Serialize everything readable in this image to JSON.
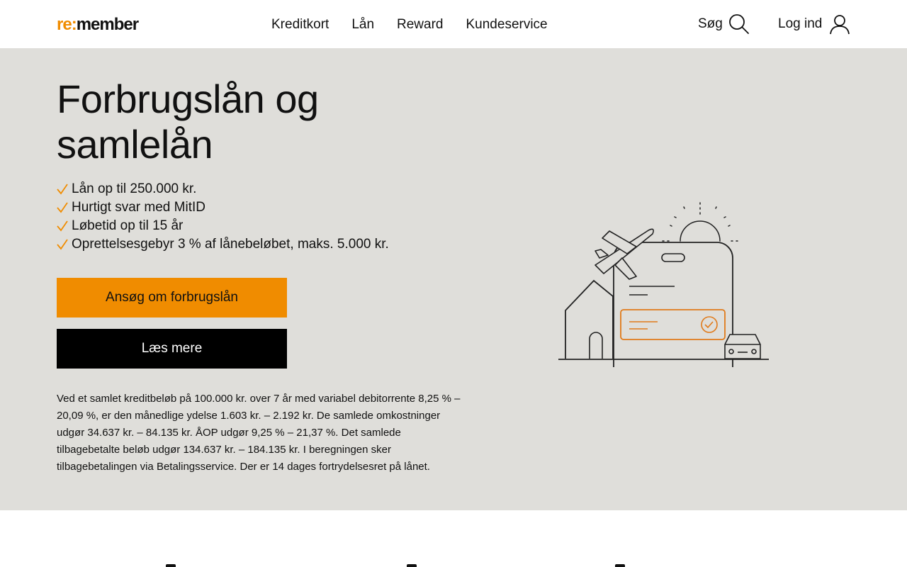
{
  "header": {
    "logo_re": "re:",
    "logo_member": "member",
    "nav": [
      {
        "label": "Kreditkort"
      },
      {
        "label": "Lån"
      },
      {
        "label": "Reward"
      },
      {
        "label": "Kundeservice"
      }
    ],
    "search_label": "Søg",
    "login_label": "Log ind"
  },
  "hero": {
    "title": "Forbrugslån og samlelån",
    "features": [
      "Lån op til 250.000 kr.",
      "Hurtigt svar med MitID",
      "Løbetid op til 15 år",
      "Oprettelsesgebyr 3 % af lånebeløbet, maks. 5.000 kr."
    ],
    "primary_button": "Ansøg om forbrugslån",
    "secondary_button": "Læs mere",
    "disclaimer": "Ved et samlet kreditbeløb på 100.000 kr. over 7 år med variabel debitorrente 8,25 % – 20,09 %, er den månedlige ydelse 1.603 kr. – 2.192 kr. De samlede omkostninger udgør 34.637 kr. – 84.135 kr. ÅOP udgør 9,25 % – 21,37 %. Det samlede tilbagebetalte beløb udgør 134.637 kr. – 184.135 kr. I beregningen sker tilbagebetalingen via Betalingsservice. Der er 14 dages fortrydelsesret på lånet."
  },
  "colors": {
    "accent": "#f08c00",
    "hero_bg": "#dfdeda",
    "dark": "#000000"
  },
  "icons": {
    "search": "search-icon",
    "user": "user-icon",
    "check": "check-icon"
  }
}
